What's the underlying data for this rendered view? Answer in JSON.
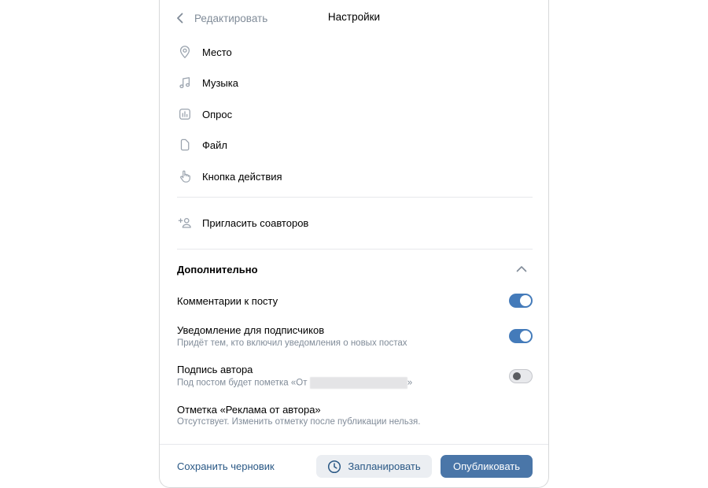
{
  "header": {
    "back_label": "Редактировать",
    "title": "Настройки"
  },
  "attachments": [
    {
      "label": "Место",
      "icon": "location-pin-icon"
    },
    {
      "label": "Музыка",
      "icon": "music-note-icon"
    },
    {
      "label": "Опрос",
      "icon": "poll-chart-icon"
    },
    {
      "label": "Файл",
      "icon": "file-icon"
    },
    {
      "label": "Кнопка действия",
      "icon": "pointer-hand-icon"
    }
  ],
  "coauthors": {
    "label": "Пригласить соавторов",
    "icon": "add-user-icon"
  },
  "advanced": {
    "title": "Дополнительно",
    "expanded": true,
    "settings": [
      {
        "title": "Комментарии к посту",
        "subtitle": "",
        "enabled": true
      },
      {
        "title": "Уведомление для подписчиков",
        "subtitle": "Придёт тем, кто включил уведомления о новых постах",
        "enabled": true
      },
      {
        "title": "Подпись автора",
        "subtitle_prefix": "Под постом будет пометка «От ",
        "subtitle_suffix": "»",
        "enabled": false
      },
      {
        "title": "Отметка «Реклама от автора»",
        "subtitle": "Отсутствует. Изменить отметку после публикации нельзя."
      }
    ]
  },
  "footer": {
    "save_draft": "Сохранить черновик",
    "schedule": "Запланировать",
    "publish": "Опубликовать"
  },
  "colors": {
    "accent": "#4a76a8",
    "toggle_on": "#447bba",
    "link": "#2a5885",
    "secondary_text": "#818c99",
    "divider": "#e7e8ec"
  }
}
